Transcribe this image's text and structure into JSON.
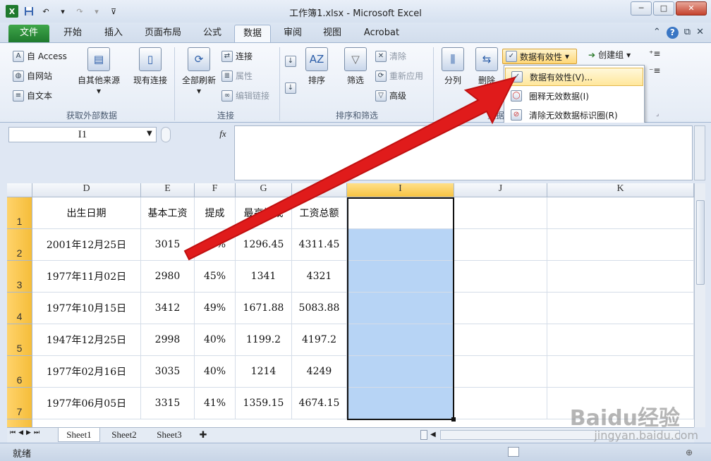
{
  "window": {
    "title": "工作簿1.xlsx - Microsoft Excel"
  },
  "qat": {
    "app_icon": "X"
  },
  "tabs": [
    {
      "label": "文件"
    },
    {
      "label": "开始"
    },
    {
      "label": "插入"
    },
    {
      "label": "页面布局"
    },
    {
      "label": "公式"
    },
    {
      "label": "数据"
    },
    {
      "label": "审阅"
    },
    {
      "label": "视图"
    },
    {
      "label": "Acrobat"
    }
  ],
  "ribbon": {
    "external": {
      "access": "自 Access",
      "web": "自网站",
      "text": "自文本",
      "other_sources": "自其他来源",
      "existing": "现有连接",
      "label": "获取外部数据"
    },
    "connections": {
      "refresh_all": "全部刷新",
      "connections": "连接",
      "properties": "属性",
      "edit_links": "编辑链接",
      "label": "连接"
    },
    "sort_filter": {
      "sort": "排序",
      "filter": "筛选",
      "clear": "清除",
      "reapply": "重新应用",
      "advanced": "高级",
      "label": "排序和筛选"
    },
    "data_tools": {
      "text_to_columns": "分列",
      "remove_duplicates": "删除",
      "data_validation": "数据有效性",
      "label": "数据"
    },
    "outline": {
      "group": "创建组"
    }
  },
  "dropdown": {
    "items": [
      {
        "label": "数据有效性(V)..."
      },
      {
        "label": "圈释无效数据(I)"
      },
      {
        "label": "清除无效数据标识圈(R)"
      }
    ]
  },
  "formula_bar": {
    "name_box": "I1",
    "fx": "fx",
    "formula": ""
  },
  "columns": [
    "D",
    "E",
    "F",
    "G",
    "H",
    "I",
    "J",
    "K"
  ],
  "rows": [
    {
      "num": "1",
      "cells": [
        "出生日期",
        "基本工资",
        "提成",
        "最高提成",
        "工资总额"
      ]
    },
    {
      "num": "2",
      "cells": [
        "2001年12月25日",
        "3015",
        "43%",
        "1296.45",
        "4311.45"
      ]
    },
    {
      "num": "3",
      "cells": [
        "1977年11月02日",
        "2980",
        "45%",
        "1341",
        "4321"
      ]
    },
    {
      "num": "4",
      "cells": [
        "1977年10月15日",
        "3412",
        "49%",
        "1671.88",
        "5083.88"
      ]
    },
    {
      "num": "5",
      "cells": [
        "1947年12月25日",
        "2998",
        "40%",
        "1199.2",
        "4197.2"
      ]
    },
    {
      "num": "6",
      "cells": [
        "1977年02月16日",
        "3035",
        "40%",
        "1214",
        "4249"
      ]
    },
    {
      "num": "7",
      "cells": [
        "1977年06月05日",
        "3315",
        "41%",
        "1359.15",
        "4674.15"
      ]
    }
  ],
  "sheets": [
    {
      "label": "Sheet1"
    },
    {
      "label": "Sheet2"
    },
    {
      "label": "Sheet3"
    }
  ],
  "status": {
    "ready": "就绪"
  },
  "watermark": {
    "brand": "Baidu经验",
    "url": "jingyan.baidu.com"
  }
}
